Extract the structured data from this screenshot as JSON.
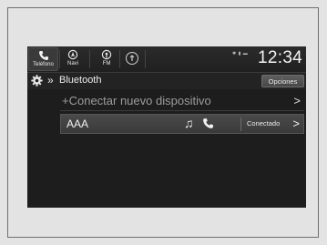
{
  "topbar": {
    "apps": [
      {
        "label": "Teléfono",
        "icon": "phone-icon"
      },
      {
        "label": "Navi",
        "icon": "navi-icon"
      },
      {
        "label": "FM",
        "icon": "radio-fm-icon"
      },
      {
        "label": "",
        "icon": "audio-source-icon"
      }
    ],
    "clock": "12:34",
    "status_icons": [
      "bluetooth-icon",
      "signal-icon",
      "battery-icon"
    ]
  },
  "header": {
    "title": "Bluetooth",
    "options_label": "Opciones",
    "icon": "settings-gear-icon"
  },
  "list": {
    "add_device": "+Conectar nuevo dispositivo",
    "devices": [
      {
        "name": "AAA",
        "status": "Conectado",
        "icons": [
          "music-note-icon",
          "phone-icon"
        ]
      }
    ]
  },
  "colors": {
    "screen_bg": "#1d1d1d",
    "selected_row": "#444444",
    "frame_bg": "#e3e3e3"
  }
}
